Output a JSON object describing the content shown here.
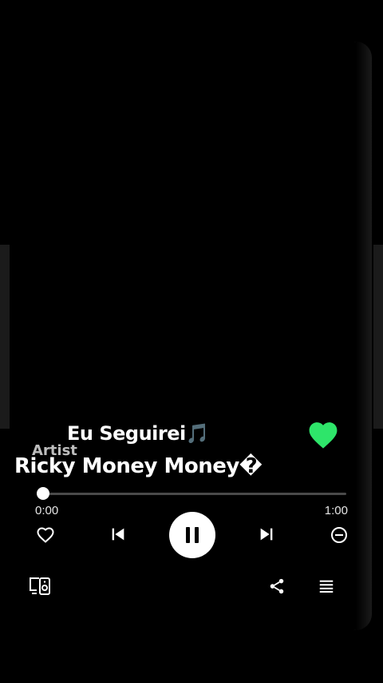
{
  "player": {
    "title": "Eu Seguirei🎵",
    "artist_label": "Artist",
    "artist_name": "Ricky Money Money�",
    "liked": true,
    "progress_fraction": 0.0,
    "time_current": "0:00",
    "time_total": "1:00"
  },
  "colors": {
    "background": "#000000",
    "accent_heart": "#2ee56a",
    "text": "#ffffff",
    "track": "#4a4a4a"
  },
  "icons": {
    "heart_filled": "heart-filled-icon",
    "heart_outline": "heart-outline-icon",
    "previous": "skip-previous-icon",
    "pause": "pause-icon",
    "next": "skip-next-icon",
    "remove": "minus-circle-icon",
    "devices": "devices-icon",
    "share": "share-icon",
    "queue": "queue-icon"
  }
}
